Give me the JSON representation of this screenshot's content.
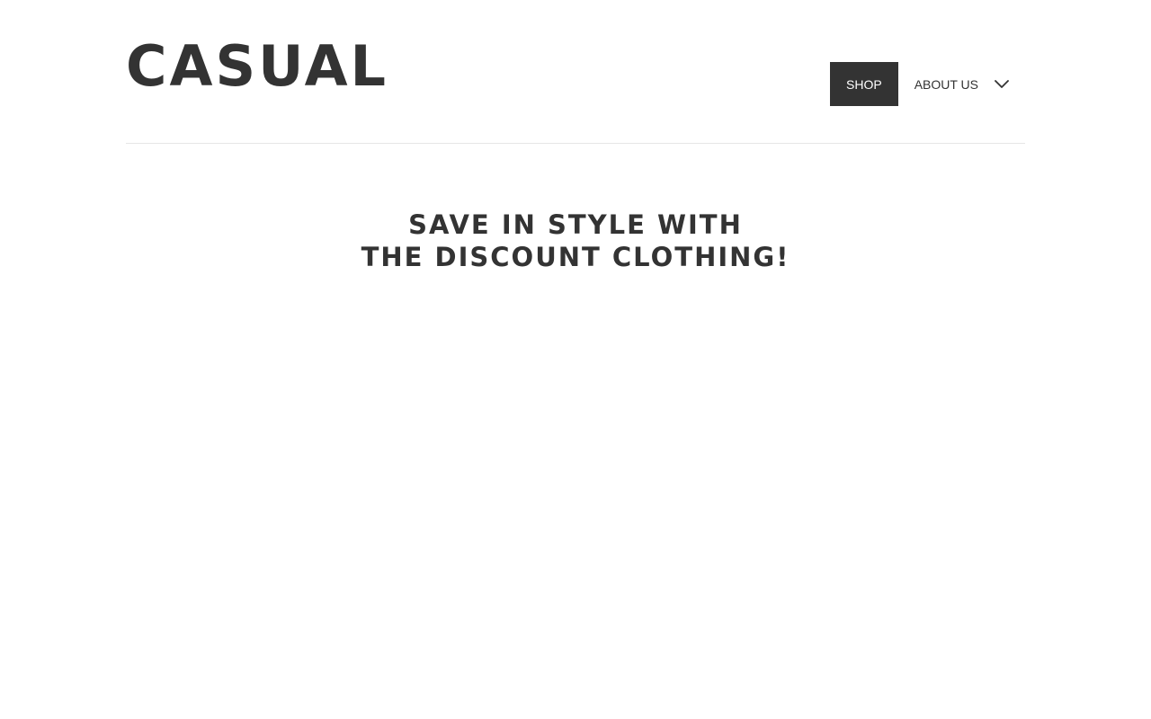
{
  "header": {
    "logo": "CASUAL",
    "nav": [
      {
        "label": "SHOP",
        "active": true
      },
      {
        "label": "ABOUT US",
        "active": false
      }
    ],
    "dropdown_icon": "chevron-down-icon"
  },
  "hero": {
    "line1": "SAVE IN STYLE WITH",
    "line2": "THE DISCOUNT CLOTHING!"
  },
  "colors": {
    "text": "#333333",
    "active_nav_bg": "#333333",
    "active_nav_text": "#ffffff",
    "divider": "#e6e6e6",
    "background": "#ffffff"
  }
}
